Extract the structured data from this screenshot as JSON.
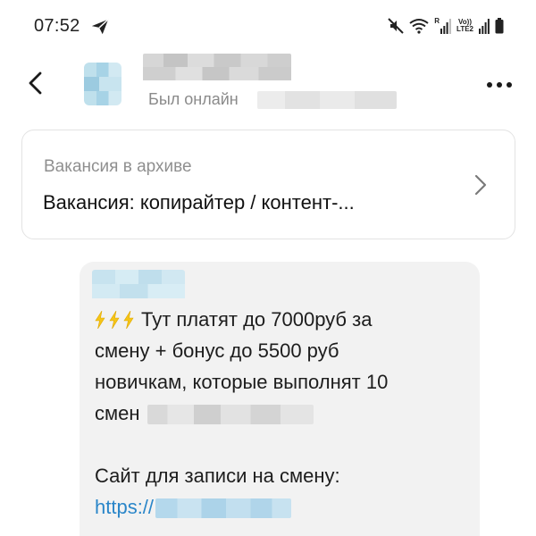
{
  "status_bar": {
    "time": "07:52",
    "icons": [
      "telegram-send-icon",
      "mute-icon",
      "wifi-icon",
      "signal-icon",
      "lte-icon",
      "battery-icon"
    ],
    "roaming_label": "R",
    "volte_label": "Vo))",
    "lte_label": "LTE2"
  },
  "header": {
    "contact_name": "",
    "status_text": "Был онлайн",
    "icons": [
      "back-arrow-icon",
      "more-vertical-icon"
    ]
  },
  "vacancy": {
    "status": "Вакансия в архиве",
    "title": "Вакансия: копирайтер / контент-..."
  },
  "message": {
    "line1": "Тут платят до 7000руб за",
    "line2": "смену + бонус до 5500 руб",
    "line3": "новичкам, которые выполнят 10",
    "line4": "смен",
    "line5": "Сайт для записи на смену:",
    "link_prefix": "https://",
    "emoji": "⚡ ⚡ ⚡"
  },
  "colors": {
    "link": "#2a86c9",
    "bubble": "#f2f2f2",
    "muted_text": "#8a8a8a",
    "bolt": "#f5c518"
  }
}
